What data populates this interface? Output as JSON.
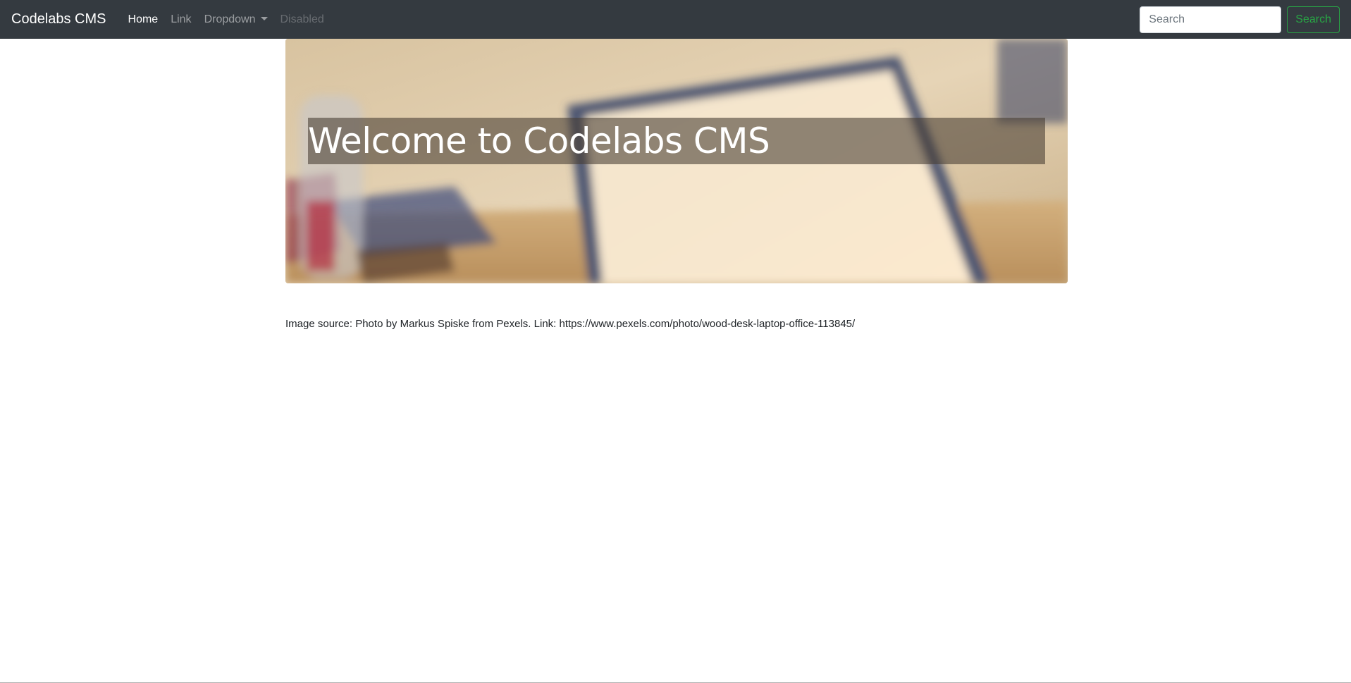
{
  "navbar": {
    "brand": "Codelabs CMS",
    "links": [
      {
        "label": "Home",
        "state": "active"
      },
      {
        "label": "Link",
        "state": "normal"
      },
      {
        "label": "Dropdown",
        "state": "normal"
      },
      {
        "label": "Disabled",
        "state": "disabled"
      }
    ],
    "search": {
      "placeholder": "Search",
      "value": "",
      "button_label": "Search"
    },
    "colors": {
      "background": "#343a40",
      "search_button": "#28a745"
    }
  },
  "hero": {
    "title": "Welcome to Codelabs CMS"
  },
  "caption": {
    "text": "Image source: Photo by Markus Spiske from Pexels. Link: https://www.pexels.com/photo/wood-desk-laptop-office-113845/"
  }
}
